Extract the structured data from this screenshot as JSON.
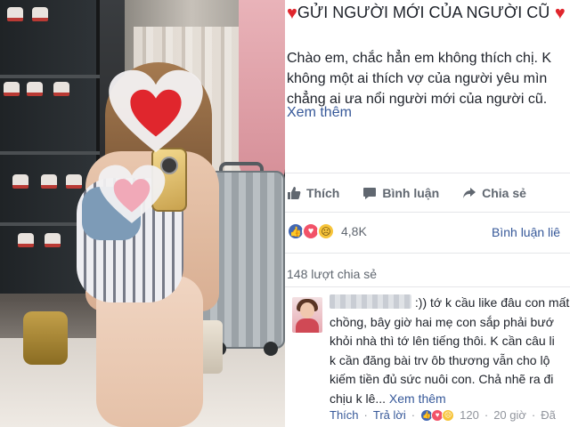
{
  "post": {
    "title": "GỬI NGƯỜI MỚI CỦA NGƯỜI CŨ",
    "body_lines": [
      "Chào em, chắc hẳn em không thích chị. K",
      "không một ai thích vợ của người yêu mìn",
      "chẳng ai ưa nổi người mới của người cũ."
    ],
    "see_more": "Xem thêm",
    "actions": {
      "like": "Thích",
      "comment": "Bình luận",
      "share": "Chia sẻ"
    },
    "reactions": {
      "count": "4,8K",
      "types": [
        "like",
        "love",
        "sad"
      ]
    },
    "comments_link": "Bình luận liê",
    "shares": "148 lượt chia sẻ"
  },
  "comment": {
    "lines": [
      ":)) tớ k cầu like đâu con mất c",
      "chồng, bây giờ hai mẹ con sắp phải bướ",
      "khỏi nhà thì tớ lên tiếng thôi. K cần câu li",
      "k cần đăng bài trv ôb thương vẫn cho lộ",
      "kiếm tiền đủ sức nuôi con. Chả nhẽ ra đi",
      "chịu k lê..."
    ],
    "see_more": "Xem thêm",
    "actions": {
      "like": "Thích",
      "reply": "Trả lời"
    },
    "reaction_count": "120",
    "time": "20 giờ",
    "edited": "Đã"
  },
  "colors": {
    "heart": "#e0262d",
    "link": "#365899",
    "like_blue": "#4267b2",
    "love_pink": "#f25268",
    "sad_yellow": "#f7c43a"
  },
  "icons": [
    "heart-icon",
    "thumbs-up-icon",
    "comment-icon",
    "share-icon",
    "like-reaction-icon",
    "love-reaction-icon",
    "sad-reaction-icon"
  ]
}
